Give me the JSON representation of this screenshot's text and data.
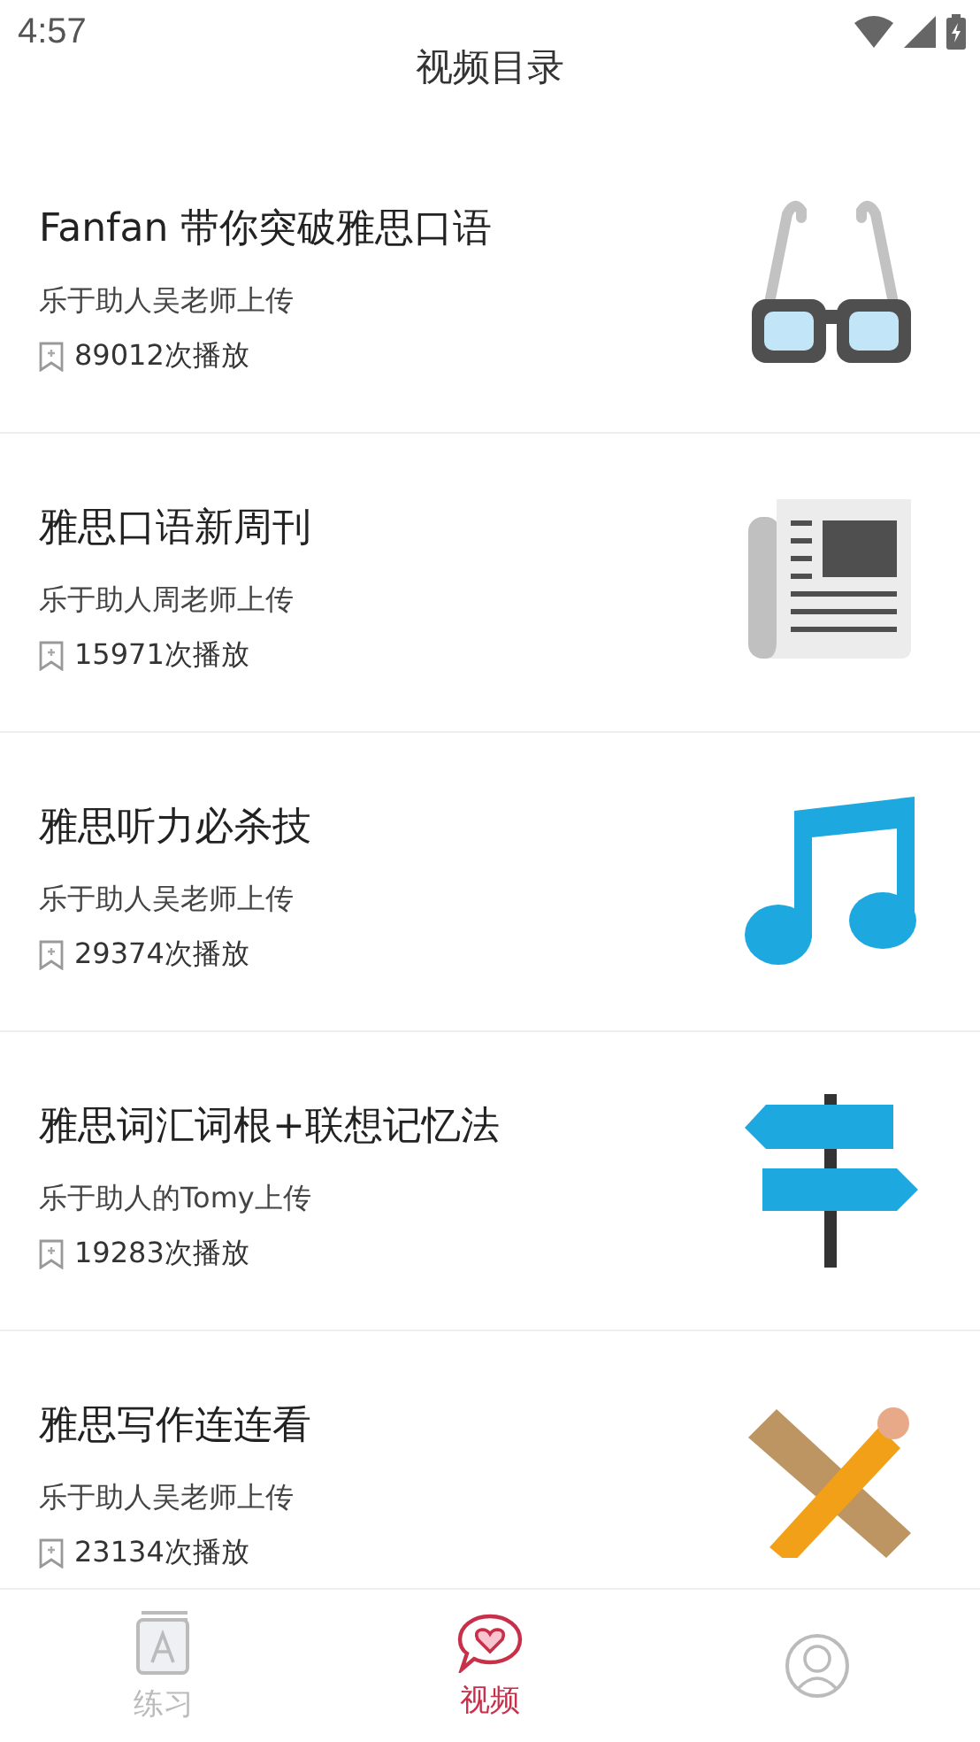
{
  "status_bar": {
    "time": "4:57"
  },
  "title": "视频目录",
  "videos": [
    {
      "title": "Fanfan 带你突破雅思口语",
      "uploader": "乐于助人吴老师上传",
      "plays": "89012次播放",
      "kind": "glasses"
    },
    {
      "title": "雅思口语新周刊",
      "uploader": "乐于助人周老师上传",
      "plays": "15971次播放",
      "kind": "newspaper"
    },
    {
      "title": "雅思听力必杀技",
      "uploader": "乐于助人吴老师上传",
      "plays": "29374次播放",
      "kind": "music"
    },
    {
      "title": "雅思词汇词根+联想记忆法",
      "uploader": "乐于助人的Tomy上传",
      "plays": "19283次播放",
      "kind": "signpost"
    },
    {
      "title": "雅思写作连连看",
      "uploader": "乐于助人吴老师上传",
      "plays": "23134次播放",
      "kind": "tools"
    }
  ],
  "tabs": [
    {
      "label": "练习",
      "kind": "book",
      "selected": false
    },
    {
      "label": "视频",
      "kind": "heart-chat",
      "selected": true
    },
    {
      "kind": "avatar",
      "selected": false
    }
  ]
}
